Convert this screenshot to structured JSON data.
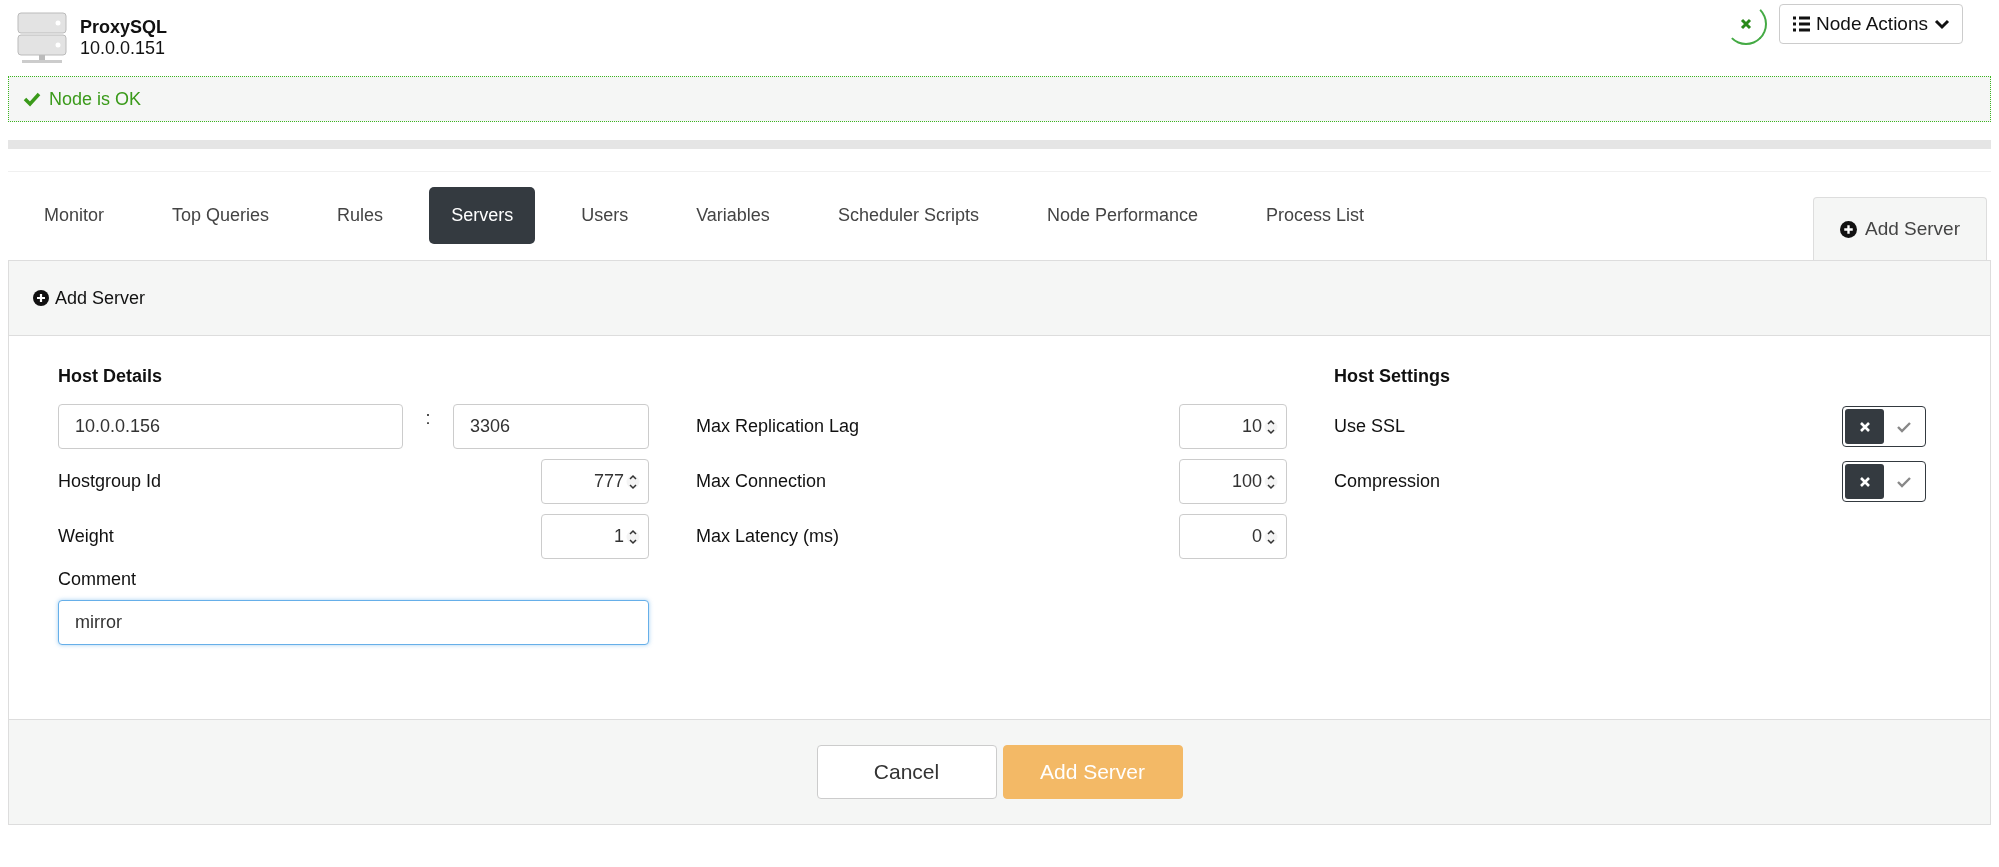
{
  "node": {
    "name": "ProxySQL",
    "address": "10.0.0.151"
  },
  "node_actions": {
    "label": "Node Actions"
  },
  "status": {
    "kind": "ok",
    "message": "Node is OK"
  },
  "tabs": [
    {
      "label": "Monitor",
      "selected": false
    },
    {
      "label": "Top Queries",
      "selected": false
    },
    {
      "label": "Rules",
      "selected": false
    },
    {
      "label": "Servers",
      "selected": true
    },
    {
      "label": "Users",
      "selected": false
    },
    {
      "label": "Variables",
      "selected": false
    },
    {
      "label": "Scheduler Scripts",
      "selected": false
    },
    {
      "label": "Node Performance",
      "selected": false
    },
    {
      "label": "Process List",
      "selected": false
    }
  ],
  "side_tab": {
    "label": "Add Server"
  },
  "panel": {
    "title": "Add Server",
    "host_details": {
      "title": "Host Details",
      "host": "10.0.0.156",
      "separator": ":",
      "port": "3306",
      "fields": [
        {
          "label": "Hostgroup Id",
          "value": "777"
        },
        {
          "label": "Weight",
          "value": "1"
        }
      ],
      "comment_label": "Comment",
      "comment": "mirror"
    },
    "limits": [
      {
        "label": "Max Replication Lag",
        "value": "10"
      },
      {
        "label": "Max Connection",
        "value": "100"
      },
      {
        "label": "Max Latency (ms)",
        "value": "0"
      }
    ],
    "host_settings": {
      "title": "Host Settings",
      "toggles": [
        {
          "label": "Use SSL",
          "on": false
        },
        {
          "label": "Compression",
          "on": false
        }
      ]
    },
    "buttons": [
      {
        "label": "Cancel",
        "kind": "secondary"
      },
      {
        "label": "Add Server",
        "kind": "primary"
      }
    ]
  }
}
